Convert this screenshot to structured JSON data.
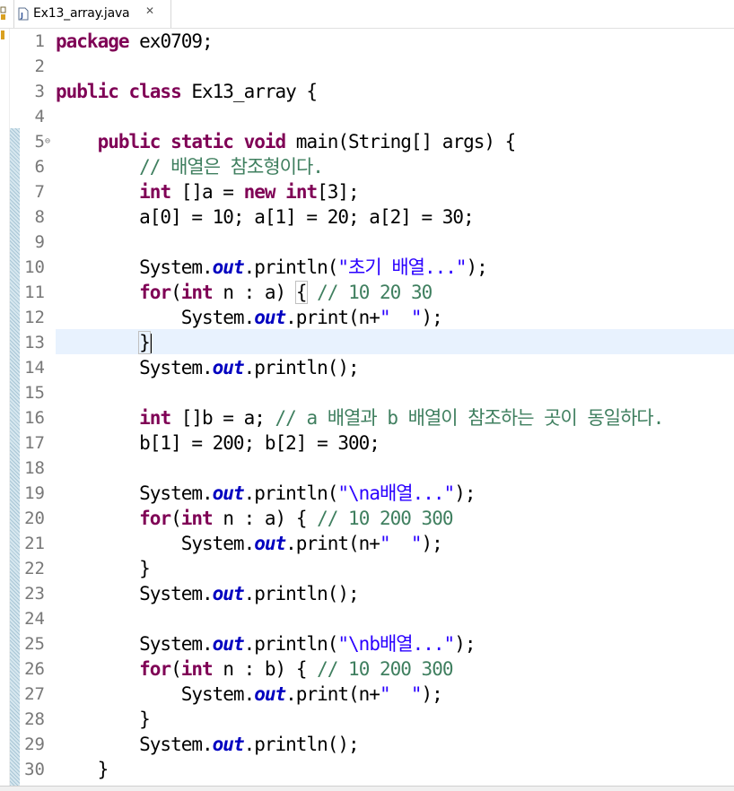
{
  "tab": {
    "title": "Ex13_array.java",
    "close": "✕"
  },
  "editor": {
    "current_line": 13,
    "lines": [
      {
        "num": "1",
        "segs": [
          {
            "t": "kw",
            "v": "package"
          },
          {
            "t": "p",
            "v": " ex0709;"
          }
        ]
      },
      {
        "num": "2",
        "segs": []
      },
      {
        "num": "3",
        "segs": [
          {
            "t": "kw",
            "v": "public class"
          },
          {
            "t": "p",
            "v": " Ex13_array {"
          }
        ]
      },
      {
        "num": "4",
        "segs": []
      },
      {
        "num": "5",
        "fold": "⊖",
        "segs": [
          {
            "t": "p",
            "v": "    "
          },
          {
            "t": "kw",
            "v": "public static void"
          },
          {
            "t": "p",
            "v": " main(String[] args) {"
          }
        ]
      },
      {
        "num": "6",
        "segs": [
          {
            "t": "p",
            "v": "        "
          },
          {
            "t": "cm",
            "v": "// 배열은 참조형이다."
          }
        ]
      },
      {
        "num": "7",
        "segs": [
          {
            "t": "p",
            "v": "        "
          },
          {
            "t": "kw",
            "v": "int"
          },
          {
            "t": "p",
            "v": " []a = "
          },
          {
            "t": "kw",
            "v": "new int"
          },
          {
            "t": "p",
            "v": "[3];"
          }
        ]
      },
      {
        "num": "8",
        "segs": [
          {
            "t": "p",
            "v": "        a[0] = 10; a[1] = 20; a[2] = 30;"
          }
        ]
      },
      {
        "num": "9",
        "segs": []
      },
      {
        "num": "10",
        "segs": [
          {
            "t": "p",
            "v": "        System."
          },
          {
            "t": "fld",
            "v": "out"
          },
          {
            "t": "p",
            "v": ".println("
          },
          {
            "t": "str",
            "v": "\"초기 배열...\""
          },
          {
            "t": "p",
            "v": ");"
          }
        ]
      },
      {
        "num": "11",
        "segs": [
          {
            "t": "p",
            "v": "        "
          },
          {
            "t": "kw",
            "v": "for"
          },
          {
            "t": "p",
            "v": "("
          },
          {
            "t": "kw",
            "v": "int"
          },
          {
            "t": "p",
            "v": " n : a) "
          },
          {
            "t": "box",
            "v": "{"
          },
          {
            "t": "p",
            "v": " "
          },
          {
            "t": "cm",
            "v": "// 10 20 30"
          }
        ]
      },
      {
        "num": "12",
        "segs": [
          {
            "t": "p",
            "v": "            System."
          },
          {
            "t": "fld",
            "v": "out"
          },
          {
            "t": "p",
            "v": ".print(n+"
          },
          {
            "t": "str",
            "v": "\"  \""
          },
          {
            "t": "p",
            "v": ");"
          }
        ]
      },
      {
        "num": "13",
        "segs": [
          {
            "t": "p",
            "v": "        "
          },
          {
            "t": "box",
            "v": "}"
          },
          {
            "t": "caret",
            "v": ""
          }
        ]
      },
      {
        "num": "14",
        "segs": [
          {
            "t": "p",
            "v": "        System."
          },
          {
            "t": "fld",
            "v": "out"
          },
          {
            "t": "p",
            "v": ".println();"
          }
        ]
      },
      {
        "num": "15",
        "segs": []
      },
      {
        "num": "16",
        "segs": [
          {
            "t": "p",
            "v": "        "
          },
          {
            "t": "kw",
            "v": "int"
          },
          {
            "t": "p",
            "v": " []b = a; "
          },
          {
            "t": "cm",
            "v": "// a 배열과 b 배열이 참조하는 곳이 동일하다."
          }
        ]
      },
      {
        "num": "17",
        "segs": [
          {
            "t": "p",
            "v": "        b[1] = 200; b[2] = 300;"
          }
        ]
      },
      {
        "num": "18",
        "segs": []
      },
      {
        "num": "19",
        "segs": [
          {
            "t": "p",
            "v": "        System."
          },
          {
            "t": "fld",
            "v": "out"
          },
          {
            "t": "p",
            "v": ".println("
          },
          {
            "t": "str",
            "v": "\"\\na배열...\""
          },
          {
            "t": "p",
            "v": ");"
          }
        ]
      },
      {
        "num": "20",
        "segs": [
          {
            "t": "p",
            "v": "        "
          },
          {
            "t": "kw",
            "v": "for"
          },
          {
            "t": "p",
            "v": "("
          },
          {
            "t": "kw",
            "v": "int"
          },
          {
            "t": "p",
            "v": " n : a) { "
          },
          {
            "t": "cm",
            "v": "// 10 200 300"
          }
        ]
      },
      {
        "num": "21",
        "segs": [
          {
            "t": "p",
            "v": "            System."
          },
          {
            "t": "fld",
            "v": "out"
          },
          {
            "t": "p",
            "v": ".print(n+"
          },
          {
            "t": "str",
            "v": "\"  \""
          },
          {
            "t": "p",
            "v": ");"
          }
        ]
      },
      {
        "num": "22",
        "segs": [
          {
            "t": "p",
            "v": "        }"
          }
        ]
      },
      {
        "num": "23",
        "segs": [
          {
            "t": "p",
            "v": "        System."
          },
          {
            "t": "fld",
            "v": "out"
          },
          {
            "t": "p",
            "v": ".println();"
          }
        ]
      },
      {
        "num": "24",
        "segs": []
      },
      {
        "num": "25",
        "segs": [
          {
            "t": "p",
            "v": "        System."
          },
          {
            "t": "fld",
            "v": "out"
          },
          {
            "t": "p",
            "v": ".println("
          },
          {
            "t": "str",
            "v": "\"\\nb배열...\""
          },
          {
            "t": "p",
            "v": ");"
          }
        ]
      },
      {
        "num": "26",
        "segs": [
          {
            "t": "p",
            "v": "        "
          },
          {
            "t": "kw",
            "v": "for"
          },
          {
            "t": "p",
            "v": "("
          },
          {
            "t": "kw",
            "v": "int"
          },
          {
            "t": "p",
            "v": " n : b) { "
          },
          {
            "t": "cm",
            "v": "// 10 200 300"
          }
        ]
      },
      {
        "num": "27",
        "segs": [
          {
            "t": "p",
            "v": "            System."
          },
          {
            "t": "fld",
            "v": "out"
          },
          {
            "t": "p",
            "v": ".print(n+"
          },
          {
            "t": "str",
            "v": "\"  \""
          },
          {
            "t": "p",
            "v": ");"
          }
        ]
      },
      {
        "num": "28",
        "segs": [
          {
            "t": "p",
            "v": "        }"
          }
        ]
      },
      {
        "num": "29",
        "segs": [
          {
            "t": "p",
            "v": "        System."
          },
          {
            "t": "fld",
            "v": "out"
          },
          {
            "t": "p",
            "v": ".println();"
          }
        ]
      },
      {
        "num": "30",
        "segs": [
          {
            "t": "p",
            "v": "    }"
          }
        ]
      }
    ]
  },
  "colors": {
    "keyword": "#7f0055",
    "field": "#0000c0",
    "comment": "#3f7f5f",
    "string": "#2a00ff",
    "current_line": "#e8f2fe"
  },
  "icons": {
    "file": "java-file-icon",
    "close": "close-icon",
    "fold": "fold-collapse-icon"
  }
}
